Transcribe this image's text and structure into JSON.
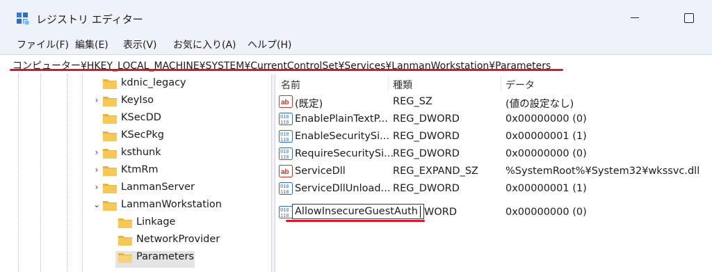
{
  "window": {
    "title": "レジストリ エディター"
  },
  "menu": [
    "ファイル(F)",
    "編集(E)",
    "表示(V)",
    "お気に入り(A)",
    "ヘルプ(H)"
  ],
  "address": "コンピューター¥HKEY_LOCAL_MACHINE¥SYSTEM¥CurrentControlSet¥Services¥LanmanWorkstation¥Parameters",
  "tree": [
    {
      "label": "kdnic_legacy",
      "expander": ""
    },
    {
      "label": "KeyIso",
      "expander": "›"
    },
    {
      "label": "KSecDD",
      "expander": ""
    },
    {
      "label": "KSecPkg",
      "expander": ""
    },
    {
      "label": "ksthunk",
      "expander": "›"
    },
    {
      "label": "KtmRm",
      "expander": "›"
    },
    {
      "label": "LanmanServer",
      "expander": "›"
    },
    {
      "label": "LanmanWorkstation",
      "expander": "⌄"
    },
    {
      "label": "Linkage",
      "expander": ""
    },
    {
      "label": "NetworkProvider",
      "expander": ""
    },
    {
      "label": "Parameters",
      "expander": ""
    }
  ],
  "list": {
    "columns": [
      "名前",
      "種類",
      "データ"
    ],
    "rows": [
      {
        "name": "(既定)",
        "type": "REG_SZ",
        "data": "(値の設定なし)",
        "icon": "string-value-icon"
      },
      {
        "name": "EnablePlainTextP...",
        "type": "REG_DWORD",
        "data": "0x00000000 (0)",
        "icon": "binary-value-icon"
      },
      {
        "name": "EnableSecuritySi...",
        "type": "REG_DWORD",
        "data": "0x00000001 (1)",
        "icon": "binary-value-icon"
      },
      {
        "name": "RequireSecuritySi...",
        "type": "REG_DWORD",
        "data": "0x00000000 (0)",
        "icon": "binary-value-icon"
      },
      {
        "name": "ServiceDll",
        "type": "REG_EXPAND_SZ",
        "data": "%SystemRoot%¥System32¥wkssvc.dll",
        "icon": "string-value-icon"
      },
      {
        "name": "ServiceDllUnload...",
        "type": "REG_DWORD",
        "data": "0x00000001 (1)",
        "icon": "binary-value-icon"
      },
      {
        "name": "AllowInsecureGuestAuth",
        "type": "WORD",
        "data": "0x00000000 (0)",
        "icon": "binary-value-icon",
        "editing": true
      }
    ]
  },
  "colors": {
    "highlight": "#d6192a",
    "folder": "#f2c14e"
  }
}
